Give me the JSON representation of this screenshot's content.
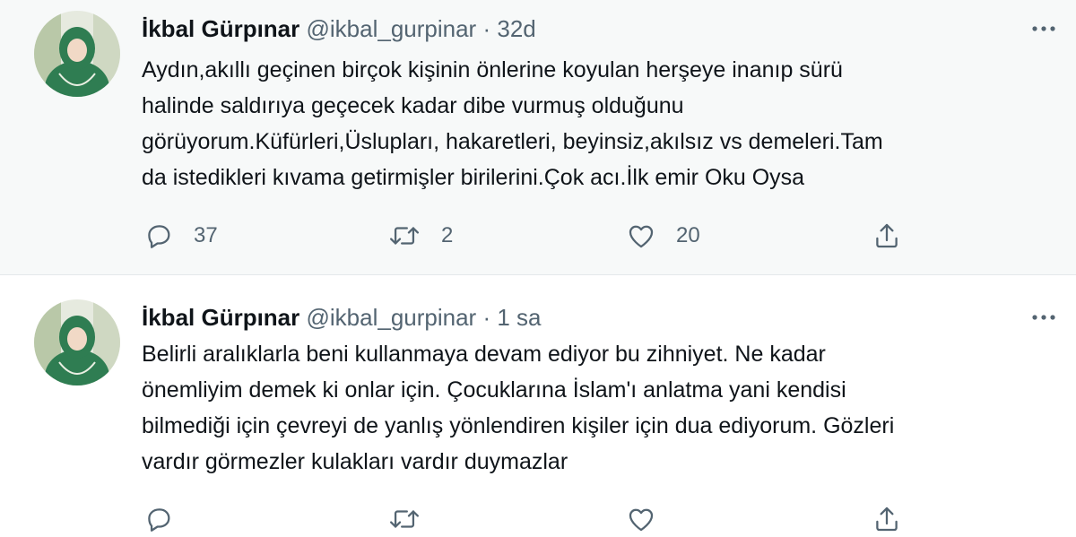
{
  "tweets": [
    {
      "name": "İkbal Gürpınar",
      "handle": "@ikbal_gurpinar",
      "separator": "·",
      "time": "32d",
      "lines": [
        "Aydın,akıllı geçinen birçok kişinin önlerine koyulan herşeye inanıp sürü",
        "halinde saldırıya geçecek kadar dibe vurmuş olduğunu",
        "görüyorum.Küfürleri,Üslupları, hakaretleri, beyinsiz,akılsız vs demeleri.Tam",
        "da istedikleri kıvama getirmişler birilerini.Çok acı.İlk emir Oku Oysa"
      ],
      "replies": "37",
      "retweets": "2",
      "likes": "20"
    },
    {
      "name": "İkbal Gürpınar",
      "handle": "@ikbal_gurpinar",
      "separator": "·",
      "time": "1 sa",
      "lines": [
        "Belirli aralıklarla beni kullanmaya devam ediyor bu zihniyet. Ne kadar",
        "önemliyim demek ki onlar için. Çocuklarına İslam'ı anlatma yani kendisi",
        "bilmediği için çevreyi de yanlış yönlendiren kişiler için dua ediyorum. Gözleri",
        "vardır görmezler kulakları vardır duymazlar"
      ]
    }
  ],
  "icons": {
    "more": "more-horizontal-icon",
    "reply": "reply-icon",
    "retweet": "retweet-icon",
    "like": "heart-icon",
    "share": "share-icon"
  },
  "colors": {
    "text": "#0f1419",
    "secondary": "#536471",
    "highlight_bg": "#f7f9f9",
    "avatar_green": "#2f7d52"
  }
}
